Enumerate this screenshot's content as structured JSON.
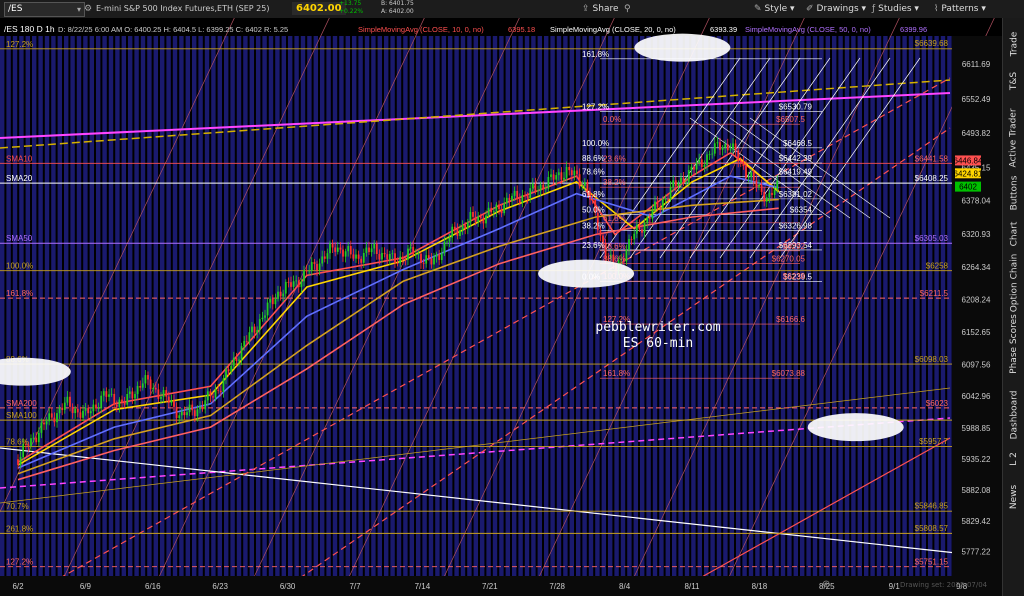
{
  "toolbar": {
    "symbol": "/ES",
    "chart_title": "/ES 180 D 1h",
    "header_details": "E-mini S&P 500 Index Futures,ETH (SEP 25)",
    "price": "6402.00",
    "change": "+13.75",
    "change_pct": "+0.22%",
    "bid": "B: 6401.75",
    "ask": "A: 6402.00",
    "share_label": "Share",
    "style_label": "Style",
    "drawings_label": "Drawings",
    "studies_label": "Studies",
    "patterns_label": "Patterns"
  },
  "study_header": {
    "ohlc": "D: 8/22/25 6:00 AM  O: 6400.25  H: 6404.5  L: 6399.25  C: 6402  R: 5.25",
    "sma10_label": "SimpleMovingAvg (CLOSE, 10, 0, no)",
    "sma10_value": "6395.18",
    "sma20_label": "SimpleMovingAvg (CLOSE, 20, 0, no)",
    "sma20_value": "6393.39",
    "sma50_label": "SimpleMovingAvg (CLOSE, 50, 0, no)",
    "sma50_value": "6399.96"
  },
  "sidebar": {
    "items": [
      "Trade",
      "T&S",
      "Active Trader",
      "Buttons",
      "Chart",
      "Option Chain",
      "Phase Scores",
      "Dashboard",
      "L 2",
      "News"
    ]
  },
  "watermark": {
    "line1": "pebblewriter.com",
    "line2": "ES 60-min"
  },
  "footer": {
    "drawing_set": "Drawing set: 2025-07/04"
  },
  "colors": {
    "background": "#000000",
    "session_stripe": "#1a1a6e",
    "sma10": "#ff5050",
    "sma20": "#ffffff",
    "sma50": "#b070ff",
    "price_badge": "#ffd400",
    "up_candle": "#22cc22",
    "down_candle": "#ff3030",
    "fib_gold": "#c8a020",
    "fib_red": "#ff6666",
    "channel_pink": "#ff44ff"
  },
  "chart_data": {
    "type": "candlestick",
    "symbol": "/ES",
    "timeframe": "1h",
    "y_ticks": [
      6611.69,
      6552.49,
      6493.82,
      6435.15,
      6378.04,
      6320.93,
      6264.34,
      6208.24,
      6152.65,
      6097.56,
      6042.96,
      5988.85,
      5935.22,
      5882.08,
      5829.42,
      5777.22
    ],
    "ylim": [
      5735,
      6660
    ],
    "x_tick_labels": [
      "6/2",
      "6/9",
      "6/16",
      "6/23",
      "6/30",
      "7/7",
      "7/14",
      "7/21",
      "7/28",
      "8/4",
      "8/11",
      "8/18",
      "8/25",
      "9/1",
      "9/8"
    ],
    "x_range_days": [
      0,
      97
    ],
    "price_path": [
      [
        0,
        5935
      ],
      [
        1,
        5960
      ],
      [
        3,
        6000
      ],
      [
        5,
        6030
      ],
      [
        7,
        6010
      ],
      [
        9,
        6045
      ],
      [
        11,
        6030
      ],
      [
        13,
        6070
      ],
      [
        15,
        6045
      ],
      [
        17,
        6010
      ],
      [
        19,
        6025
      ],
      [
        21,
        6060
      ],
      [
        23,
        6120
      ],
      [
        25,
        6170
      ],
      [
        27,
        6220
      ],
      [
        29,
        6240
      ],
      [
        31,
        6270
      ],
      [
        33,
        6300
      ],
      [
        35,
        6280
      ],
      [
        37,
        6295
      ],
      [
        39,
        6275
      ],
      [
        41,
        6290
      ],
      [
        43,
        6270
      ],
      [
        45,
        6320
      ],
      [
        47,
        6345
      ],
      [
        49,
        6355
      ],
      [
        51,
        6380
      ],
      [
        53,
        6390
      ],
      [
        55,
        6410
      ],
      [
        57,
        6430
      ],
      [
        59,
        6405
      ],
      [
        61,
        6290
      ],
      [
        62,
        6260
      ],
      [
        64,
        6320
      ],
      [
        66,
        6360
      ],
      [
        68,
        6400
      ],
      [
        70,
        6430
      ],
      [
        72,
        6460
      ],
      [
        73,
        6475
      ],
      [
        74,
        6470
      ],
      [
        75,
        6445
      ],
      [
        76,
        6420
      ],
      [
        77,
        6395
      ],
      [
        78,
        6385
      ],
      [
        79,
        6402
      ]
    ],
    "sma_lines": [
      {
        "name": "SMA10",
        "points": [
          [
            0,
            5930
          ],
          [
            10,
            6030
          ],
          [
            20,
            6060
          ],
          [
            30,
            6250
          ],
          [
            40,
            6280
          ],
          [
            50,
            6370
          ],
          [
            58,
            6420
          ],
          [
            62,
            6320
          ],
          [
            70,
            6420
          ],
          [
            74,
            6460
          ],
          [
            79,
            6395
          ]
        ]
      },
      {
        "name": "SMA20",
        "points": [
          [
            0,
            5925
          ],
          [
            10,
            6020
          ],
          [
            20,
            6045
          ],
          [
            30,
            6230
          ],
          [
            40,
            6275
          ],
          [
            50,
            6360
          ],
          [
            58,
            6410
          ],
          [
            64,
            6330
          ],
          [
            70,
            6410
          ],
          [
            75,
            6450
          ],
          [
            79,
            6393
          ]
        ]
      },
      {
        "name": "SMA50",
        "points": [
          [
            0,
            5920
          ],
          [
            10,
            5990
          ],
          [
            20,
            6030
          ],
          [
            30,
            6180
          ],
          [
            40,
            6260
          ],
          [
            50,
            6330
          ],
          [
            58,
            6390
          ],
          [
            66,
            6350
          ],
          [
            74,
            6420
          ],
          [
            79,
            6400
          ]
        ]
      },
      {
        "name": "SMA100",
        "points": [
          [
            0,
            5910
          ],
          [
            10,
            5970
          ],
          [
            20,
            6010
          ],
          [
            30,
            6130
          ],
          [
            40,
            6240
          ],
          [
            50,
            6300
          ],
          [
            60,
            6350
          ],
          [
            70,
            6370
          ],
          [
            79,
            6380
          ]
        ]
      },
      {
        "name": "SMA200",
        "points": [
          [
            0,
            5900
          ],
          [
            10,
            5950
          ],
          [
            20,
            5990
          ],
          [
            30,
            6090
          ],
          [
            40,
            6200
          ],
          [
            50,
            6270
          ],
          [
            60,
            6320
          ],
          [
            70,
            6350
          ],
          [
            79,
            6365
          ]
        ]
      }
    ],
    "left_labels": [
      {
        "text": "127.2%",
        "y": 6638,
        "color": "#c8a020"
      },
      {
        "text": "SMA10",
        "y": 6442,
        "color": "#ff5050"
      },
      {
        "text": "SMA20",
        "y": 6408,
        "color": "#ffffff"
      },
      {
        "text": "SMA50",
        "y": 6305,
        "color": "#b070ff"
      },
      {
        "text": "100.0%",
        "y": 6258,
        "color": "#c8a020"
      },
      {
        "text": "161.8%",
        "y": 6211,
        "color": "#ff6666"
      },
      {
        "text": "88.6%",
        "y": 6098,
        "color": "#c8a020"
      },
      {
        "text": "SMA200",
        "y": 6023,
        "color": "#ff6666"
      },
      {
        "text": "SMA100",
        "y": 6002,
        "color": "#c8a020"
      },
      {
        "text": "78.6%",
        "y": 5957,
        "color": "#c8a020"
      },
      {
        "text": "70.7%",
        "y": 5846,
        "color": "#c8a020"
      },
      {
        "text": "261.8%",
        "y": 5808,
        "color": "#c8a020"
      },
      {
        "text": "127.2%",
        "y": 5751,
        "color": "#ff6666"
      }
    ],
    "right_labels": [
      {
        "text": "$6639.68",
        "y": 6639.68,
        "color": "#c8a020"
      },
      {
        "text": "$6441.58",
        "y": 6441.58,
        "color": "#ff6666"
      },
      {
        "text": "$6408.25",
        "y": 6408.25,
        "color": "#ffffff"
      },
      {
        "text": "$6305.03",
        "y": 6305.03,
        "color": "#b070ff"
      },
      {
        "text": "$6258",
        "y": 6258,
        "color": "#c8a020"
      },
      {
        "text": "$6211.5",
        "y": 6211.5,
        "color": "#ff6666"
      },
      {
        "text": "$6098.03",
        "y": 6098.03,
        "color": "#c8a020"
      },
      {
        "text": "$6023",
        "y": 6023,
        "color": "#ff6666"
      },
      {
        "text": "$5957.7",
        "y": 5957.7,
        "color": "#c8a020"
      },
      {
        "text": "$5846.85",
        "y": 5846.85,
        "color": "#c8a020"
      },
      {
        "text": "$5808.57",
        "y": 5808.57,
        "color": "#c8a020"
      },
      {
        "text": "$5751.15",
        "y": 5751.15,
        "color": "#ff6666"
      }
    ],
    "price_badges": [
      {
        "text": "6446.84",
        "y": 6446.84,
        "bg": "#ff5050",
        "fg": "#000000"
      },
      {
        "text": "6424.81",
        "y": 6424.81,
        "bg": "#ffd400",
        "fg": "#000000"
      },
      {
        "text": "6402",
        "y": 6402,
        "bg": "#00c000",
        "fg": "#000000"
      }
    ],
    "fib_white": [
      {
        "text": "161.8%",
        "y": 6621
      },
      {
        "text": "127.2%",
        "y": 6530.79
      },
      {
        "text": "100.0%",
        "y": 6468.5
      },
      {
        "text": "88.6%",
        "y": 6442.39
      },
      {
        "text": "78.6%",
        "y": 6419.49
      },
      {
        "text": "61.8%",
        "y": 6381.02
      },
      {
        "text": "50.0%",
        "y": 6354
      },
      {
        "text": "38.2%",
        "y": 6326.98
      },
      {
        "text": "23.6%",
        "y": 6293.54
      },
      {
        "text": "0.0%",
        "y": 6239.5
      }
    ],
    "fib_white_values": [
      "$6530.79",
      "$6468.5",
      "$6442.39",
      "$6419.49",
      "$6381.02",
      "$6354",
      "$6326.98",
      "$6293.54",
      "$6239.5"
    ],
    "fib_red": [
      {
        "text": "0.0%",
        "y": 6509,
        "value": "$6507.5"
      },
      {
        "text": "23.6%",
        "y": 6442,
        "value": ""
      },
      {
        "text": "38.2%",
        "y": 6401,
        "value": ""
      },
      {
        "text": "61.8%",
        "y": 6340,
        "value": ""
      },
      {
        "text": "78.6%",
        "y": 6292,
        "value": "$6292"
      },
      {
        "text": "88.6%",
        "y": 6270,
        "value": "$6270.05"
      },
      {
        "text": "100.0%",
        "y": 6240,
        "value": "$6238"
      },
      {
        "text": "127.2%",
        "y": 6166.6,
        "value": "$6166.6"
      },
      {
        "text": "161.8%",
        "y": 6073.88,
        "value": "$6073.88"
      }
    ],
    "ellipses": [
      {
        "x": 69,
        "y": 6640
      },
      {
        "x": 59,
        "y": 6253
      },
      {
        "x": 0.5,
        "y": 6085
      },
      {
        "x": 87,
        "y": 5990
      }
    ],
    "last_price": 6402,
    "grid": false
  }
}
